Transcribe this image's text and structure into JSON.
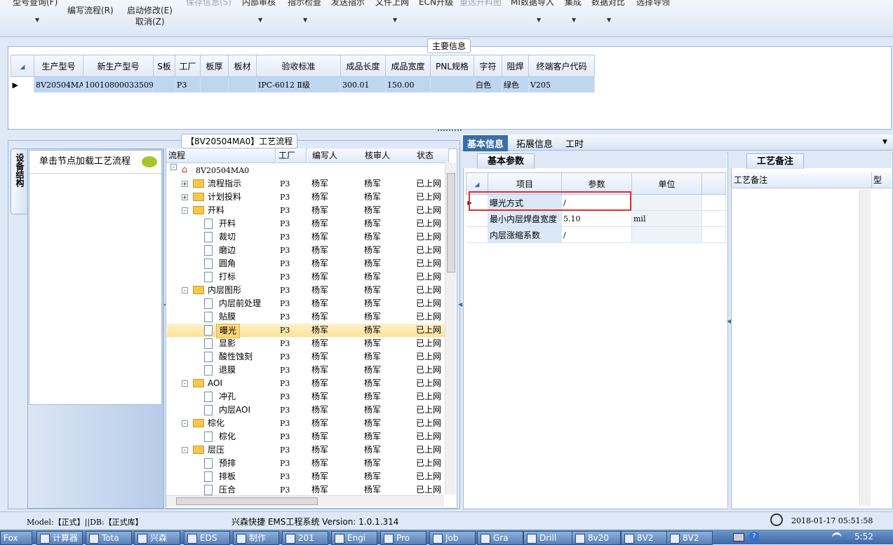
{
  "toolbar": {
    "top_row": [
      "型号查询(F)",
      "保存信息(S)",
      "内部审核",
      "指示检查",
      "发送指示",
      "文件上网",
      "ECN升级",
      "重选开料图",
      "MI数据导入",
      "集成",
      "数据对比",
      "选择导领"
    ],
    "edit_flow": "编写流程(R)",
    "start_modify": "启动修改(E)",
    "cancel": "取消(Z)"
  },
  "main_info": {
    "title": "主要信息",
    "columns": [
      "生产型号",
      "新生产型号",
      "S板",
      "工厂",
      "板厚",
      "板材",
      "验收标准",
      "成品长度",
      "成品宽度",
      "PNL规格",
      "字符",
      "阻焊",
      "终端客户代码"
    ],
    "row": [
      "8V20504MA0",
      "10010800033509",
      "",
      "P3",
      "",
      "",
      "IPC-6012 Ⅱ级",
      "300.01",
      "150.00",
      "",
      "白色",
      "绿色",
      "V205"
    ]
  },
  "process": {
    "title": "【8V20504MA0】工艺流程",
    "side_tab": "设备结构",
    "hint": "单击节点加载工艺流程",
    "tree_columns": [
      "流程",
      "工厂",
      "编写人",
      "核审人",
      "状态"
    ],
    "root": "8V20504MA0",
    "nodes": [
      {
        "label": "流程指示",
        "level": 1,
        "type": "folder",
        "exp": "+",
        "factory": "P3",
        "writer": "杨军",
        "reviewer": "杨军",
        "status": "已上网"
      },
      {
        "label": "计划投料",
        "level": 1,
        "type": "folder",
        "exp": "+",
        "factory": "P3",
        "writer": "杨军",
        "reviewer": "杨军",
        "status": "已上网"
      },
      {
        "label": "开料",
        "level": 1,
        "type": "folder",
        "exp": "-",
        "factory": "P3",
        "writer": "杨军",
        "reviewer": "杨军",
        "status": "已上网"
      },
      {
        "label": "开料",
        "level": 2,
        "type": "doc",
        "factory": "P3",
        "writer": "杨军",
        "reviewer": "杨军",
        "status": "已上网"
      },
      {
        "label": "裁切",
        "level": 2,
        "type": "doc",
        "factory": "P3",
        "writer": "杨军",
        "reviewer": "杨军",
        "status": "已上网"
      },
      {
        "label": "磨边",
        "level": 2,
        "type": "doc",
        "factory": "P3",
        "writer": "杨军",
        "reviewer": "杨军",
        "status": "已上网"
      },
      {
        "label": "圆角",
        "level": 2,
        "type": "doc",
        "factory": "P3",
        "writer": "杨军",
        "reviewer": "杨军",
        "status": "已上网"
      },
      {
        "label": "打标",
        "level": 2,
        "type": "doc",
        "factory": "P3",
        "writer": "杨军",
        "reviewer": "杨军",
        "status": "已上网"
      },
      {
        "label": "内层图形",
        "level": 1,
        "type": "folder",
        "exp": "-",
        "factory": "P3",
        "writer": "杨军",
        "reviewer": "杨军",
        "status": "已上网"
      },
      {
        "label": "内层前处理",
        "level": 2,
        "type": "doc",
        "factory": "P3",
        "writer": "杨军",
        "reviewer": "杨军",
        "status": "已上网"
      },
      {
        "label": "贴膜",
        "level": 2,
        "type": "doc",
        "factory": "P3",
        "writer": "杨军",
        "reviewer": "杨军",
        "status": "已上网"
      },
      {
        "label": "曝光",
        "level": 2,
        "type": "doc",
        "factory": "P3",
        "writer": "杨军",
        "reviewer": "杨军",
        "status": "已上网",
        "selected": true
      },
      {
        "label": "显影",
        "level": 2,
        "type": "doc",
        "factory": "P3",
        "writer": "杨军",
        "reviewer": "杨军",
        "status": "已上网"
      },
      {
        "label": "酸性蚀刻",
        "level": 2,
        "type": "doc",
        "factory": "P3",
        "writer": "杨军",
        "reviewer": "杨军",
        "status": "已上网"
      },
      {
        "label": "退膜",
        "level": 2,
        "type": "doc",
        "factory": "P3",
        "writer": "杨军",
        "reviewer": "杨军",
        "status": "已上网"
      },
      {
        "label": "AOI",
        "level": 1,
        "type": "folder",
        "exp": "-",
        "factory": "P3",
        "writer": "杨军",
        "reviewer": "杨军",
        "status": "已上网"
      },
      {
        "label": "冲孔",
        "level": 2,
        "type": "doc",
        "factory": "P3",
        "writer": "杨军",
        "reviewer": "杨军",
        "status": "已上网"
      },
      {
        "label": "内层AOI",
        "level": 2,
        "type": "doc",
        "factory": "P3",
        "writer": "杨军",
        "reviewer": "杨军",
        "status": "已上网"
      },
      {
        "label": "棕化",
        "level": 1,
        "type": "folder",
        "exp": "-",
        "factory": "P3",
        "writer": "杨军",
        "reviewer": "杨军",
        "status": "已上网"
      },
      {
        "label": "棕化",
        "level": 2,
        "type": "doc",
        "factory": "P3",
        "writer": "杨军",
        "reviewer": "杨军",
        "status": "已上网"
      },
      {
        "label": "层压",
        "level": 1,
        "type": "folder",
        "exp": "-",
        "factory": "P3",
        "writer": "杨军",
        "reviewer": "杨军",
        "status": "已上网"
      },
      {
        "label": "预排",
        "level": 2,
        "type": "doc",
        "factory": "P3",
        "writer": "杨军",
        "reviewer": "杨军",
        "status": "已上网"
      },
      {
        "label": "排板",
        "level": 2,
        "type": "doc",
        "factory": "P3",
        "writer": "杨军",
        "reviewer": "杨军",
        "status": "已上网"
      },
      {
        "label": "压合",
        "level": 2,
        "type": "doc",
        "factory": "P3",
        "writer": "杨军",
        "reviewer": "杨军",
        "status": "已上网"
      }
    ]
  },
  "right_tabs": [
    "基本信息",
    "拓展信息",
    "工时"
  ],
  "basic_params": {
    "title": "基本参数",
    "columns": [
      "项目",
      "参数",
      "单位"
    ],
    "rows": [
      {
        "item": "曝光方式",
        "param": "/",
        "unit": ""
      },
      {
        "item": "最小内层焊盘宽度",
        "param": "5.10",
        "unit": "mil"
      },
      {
        "item": "内层涨缩系数",
        "param": "/",
        "unit": ""
      }
    ]
  },
  "remarks": {
    "title": "工艺备注",
    "col1": "工艺备注",
    "col2": "型"
  },
  "status_bar": {
    "model": "Model:【正式】||DB:【正式库】",
    "system": "兴森快捷 EMS工程系统 Version: 1.0.1.314",
    "datetime": "2018-01-17 05:51:58"
  },
  "taskbar": {
    "items": [
      "Fox",
      "计算器",
      "Tota",
      "兴森",
      "EDS",
      "制作",
      "201",
      "Engi",
      "Pro",
      "Job",
      "Gra",
      "Drill",
      "8v20",
      "8V2",
      "8V2"
    ],
    "clock": "5:52"
  }
}
